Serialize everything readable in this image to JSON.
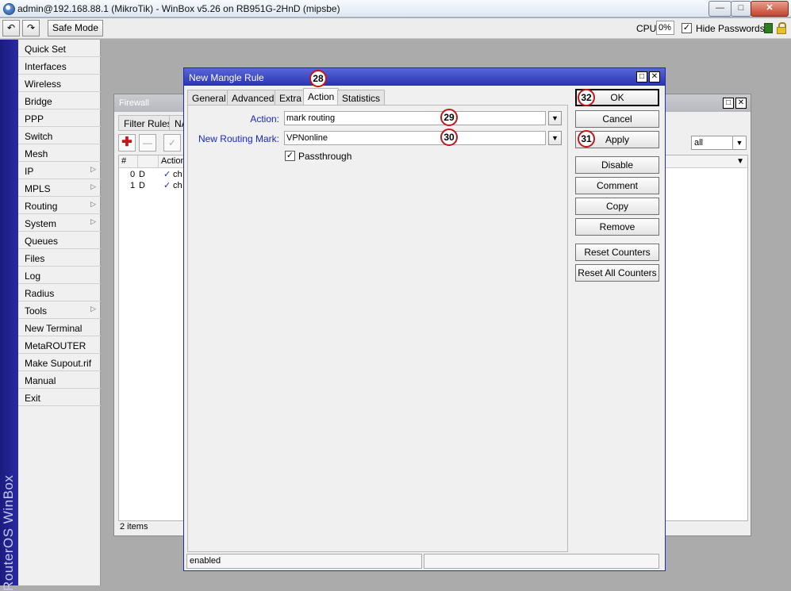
{
  "window": {
    "title": "admin@192.168.88.1 (MikroTik) - WinBox v5.26 on RB951G-2HnD (mipsbe)"
  },
  "toolbar": {
    "safe_mode_label": "Safe Mode",
    "cpu_label": "CPU:",
    "cpu_value": "0%",
    "hide_passwords_label": "Hide Passwords",
    "hide_passwords_checked": true
  },
  "brand": {
    "vertical_text": "RouterOS WinBox"
  },
  "menu": {
    "items": [
      {
        "label": "Quick Set",
        "has_submenu": false
      },
      {
        "label": "Interfaces",
        "has_submenu": false
      },
      {
        "label": "Wireless",
        "has_submenu": false
      },
      {
        "label": "Bridge",
        "has_submenu": false
      },
      {
        "label": "PPP",
        "has_submenu": false
      },
      {
        "label": "Switch",
        "has_submenu": false
      },
      {
        "label": "Mesh",
        "has_submenu": false
      },
      {
        "label": "IP",
        "has_submenu": true
      },
      {
        "label": "MPLS",
        "has_submenu": true
      },
      {
        "label": "Routing",
        "has_submenu": true
      },
      {
        "label": "System",
        "has_submenu": true
      },
      {
        "label": "Queues",
        "has_submenu": false
      },
      {
        "label": "Files",
        "has_submenu": false
      },
      {
        "label": "Log",
        "has_submenu": false
      },
      {
        "label": "Radius",
        "has_submenu": false
      },
      {
        "label": "Tools",
        "has_submenu": true
      },
      {
        "label": "New Terminal",
        "has_submenu": false
      },
      {
        "label": "MetaROUTER",
        "has_submenu": false
      },
      {
        "label": "Make Supout.rif",
        "has_submenu": false
      },
      {
        "label": "Manual",
        "has_submenu": false
      },
      {
        "label": "Exit",
        "has_submenu": false
      }
    ]
  },
  "firewall": {
    "title": "Firewall",
    "tabs": [
      "Filter Rules",
      "NA"
    ],
    "filter_value": "all",
    "columns": [
      "#",
      "Action"
    ],
    "rows": [
      {
        "num": "0",
        "flag": "D",
        "action": "ch"
      },
      {
        "num": "1",
        "flag": "D",
        "action": "ch"
      }
    ],
    "item_count": "2 items"
  },
  "dialog": {
    "title": "New Mangle Rule",
    "tabs": [
      "General",
      "Advanced",
      "Extra",
      "Action",
      "Statistics"
    ],
    "active_tab": "Action",
    "fields": {
      "action_label": "Action:",
      "action_value": "mark routing",
      "routing_mark_label": "New Routing Mark:",
      "routing_mark_value": "VPNonline",
      "passthrough_label": "Passthrough",
      "passthrough_checked": true
    },
    "buttons": {
      "ok": "OK",
      "cancel": "Cancel",
      "apply": "Apply",
      "disable": "Disable",
      "comment": "Comment",
      "copy": "Copy",
      "remove": "Remove",
      "reset_counters": "Reset Counters",
      "reset_all_counters": "Reset All Counters"
    },
    "status": "enabled"
  },
  "annotations": {
    "tab_step": "28",
    "action_step": "29",
    "routing_mark_step": "30",
    "apply_step": "31",
    "ok_step": "32"
  },
  "colors": {
    "dialog_title": "#2733b3",
    "field_label": "#1a28c4",
    "brand_strip": "#1a1a7e",
    "badge_border": "#c0171b"
  }
}
